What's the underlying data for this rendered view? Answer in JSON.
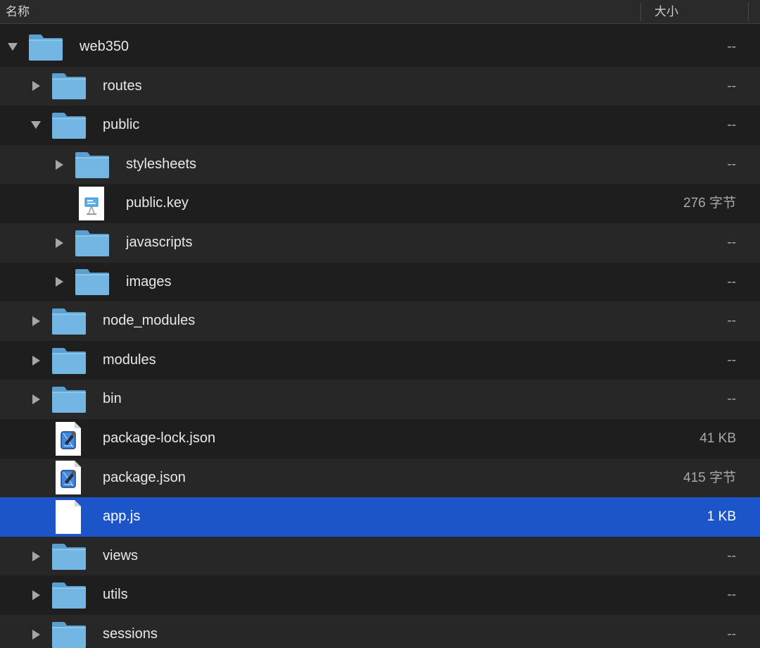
{
  "header": {
    "name_label": "名称",
    "size_label": "大小"
  },
  "rows": [
    {
      "label": "web350",
      "size": "--",
      "kind": "folder",
      "depth": 0,
      "expanded": true
    },
    {
      "label": "routes",
      "size": "--",
      "kind": "folder",
      "depth": 1,
      "expanded": false
    },
    {
      "label": "public",
      "size": "--",
      "kind": "folder",
      "depth": 1,
      "expanded": true
    },
    {
      "label": "stylesheets",
      "size": "--",
      "kind": "folder",
      "depth": 2,
      "expanded": false
    },
    {
      "label": "public.key",
      "size": "276 字节",
      "kind": "keynote",
      "depth": 2
    },
    {
      "label": "javascripts",
      "size": "--",
      "kind": "folder",
      "depth": 2,
      "expanded": false
    },
    {
      "label": "images",
      "size": "--",
      "kind": "folder",
      "depth": 2,
      "expanded": false
    },
    {
      "label": "node_modules",
      "size": "--",
      "kind": "folder",
      "depth": 1,
      "expanded": false
    },
    {
      "label": "modules",
      "size": "--",
      "kind": "folder",
      "depth": 1,
      "expanded": false
    },
    {
      "label": "bin",
      "size": "--",
      "kind": "folder",
      "depth": 1,
      "expanded": false
    },
    {
      "label": "package-lock.json",
      "size": "41 KB",
      "kind": "xcode-doc",
      "depth": 1
    },
    {
      "label": "package.json",
      "size": "415 字节",
      "kind": "xcode-doc",
      "depth": 1
    },
    {
      "label": "app.js",
      "size": "1 KB",
      "kind": "blank-doc",
      "depth": 1,
      "selected": true
    },
    {
      "label": "views",
      "size": "--",
      "kind": "folder",
      "depth": 1,
      "expanded": false
    },
    {
      "label": "utils",
      "size": "--",
      "kind": "folder",
      "depth": 1,
      "expanded": false
    },
    {
      "label": "sessions",
      "size": "--",
      "kind": "folder",
      "depth": 1,
      "expanded": false
    }
  ],
  "colors": {
    "background": "#1e1e1e",
    "alt_row": "#272727",
    "selection": "#1c55c9",
    "folder": "#6fb3e2"
  }
}
